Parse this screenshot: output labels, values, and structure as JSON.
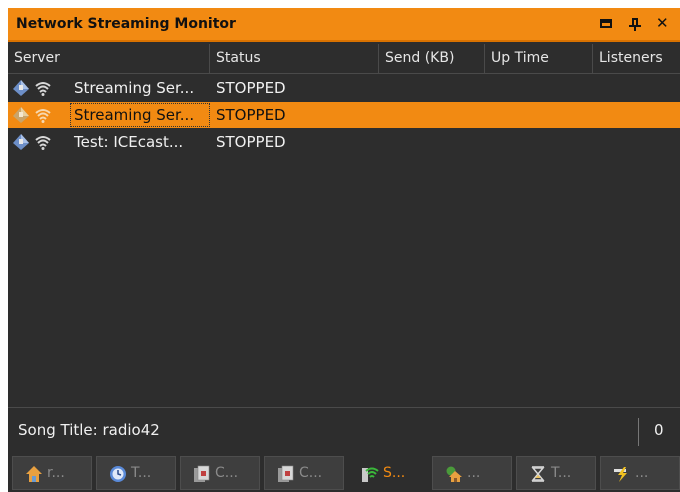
{
  "window": {
    "title": "Network Streaming Monitor",
    "controls": [
      "restore-icon",
      "pin-icon",
      "close-icon"
    ],
    "close_glyph": "✕"
  },
  "columns": {
    "server": "Server",
    "status": "Status",
    "send": "Send (KB)",
    "uptime": "Up Time",
    "listeners": "Listeners"
  },
  "rows": [
    {
      "server": "Streaming Ser...",
      "status": "STOPPED",
      "selected": false,
      "icons": [
        "network-icon",
        "wifi-icon"
      ]
    },
    {
      "server": "Streaming Ser...",
      "status": "STOPPED",
      "selected": true,
      "icons": [
        "network-icon",
        "wifi-icon"
      ]
    },
    {
      "server": "Test: ICEcast...",
      "status": "STOPPED",
      "selected": false,
      "icons": [
        "network-icon",
        "wifi-icon"
      ]
    }
  ],
  "status_bar": {
    "song_title": "Song Title: radio42",
    "count": "0"
  },
  "tabs": [
    {
      "label": "r...",
      "icon": "home-icon",
      "active": false
    },
    {
      "label": "T...",
      "icon": "clock-icon",
      "active": false
    },
    {
      "label": "C...",
      "icon": "cards-icon",
      "active": false
    },
    {
      "label": "C...",
      "icon": "cards-icon",
      "active": false
    },
    {
      "label": "S...",
      "icon": "wifi-icon",
      "active": true
    },
    {
      "label": "...",
      "icon": "house-plant-icon",
      "active": false
    },
    {
      "label": "T...",
      "icon": "hourglass-icon",
      "active": false
    },
    {
      "label": "...",
      "icon": "lightning-icon",
      "active": false
    }
  ],
  "colors": {
    "accent": "#f28a12",
    "background": "#2d2d2d",
    "text": "#f0f0f0"
  }
}
